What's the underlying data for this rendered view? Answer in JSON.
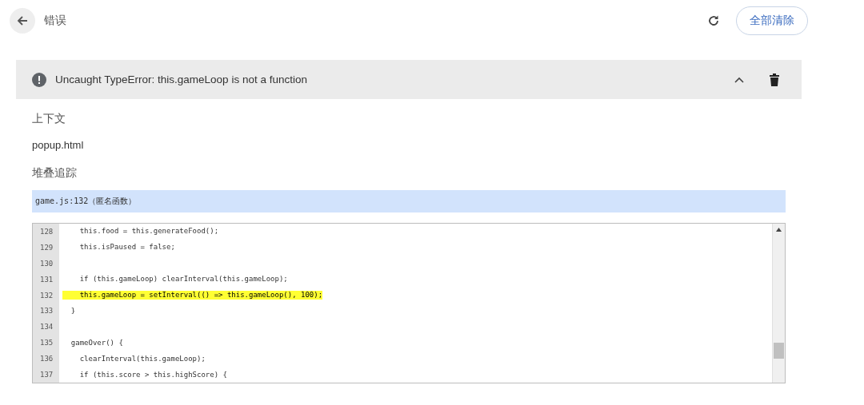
{
  "header": {
    "title": "错误",
    "clear_all_button": "全部清除"
  },
  "error": {
    "message": "Uncaught TypeError: this.gameLoop is not a function",
    "expanded": true,
    "context_label": "上下文",
    "context": "popup.html",
    "stack_label": "堆叠追踪",
    "stack_frames": [
      {
        "text": "game.js:132（匿名函数）",
        "selected": true
      }
    ]
  },
  "code": {
    "lines": [
      {
        "number": "128",
        "text": "    this.food = this.generateFood();",
        "highlighted": false
      },
      {
        "number": "129",
        "text": "    this.isPaused = false;",
        "highlighted": false
      },
      {
        "number": "130",
        "highlighted": false
      },
      {
        "number": "131",
        "text": "    if (this.gameLoop) clearInterval(this.gameLoop);",
        "highlighted": false
      },
      {
        "number": "132",
        "text": "    this.gameLoop = setInterval(() => this.gameLoop(), 100);",
        "highlighted": true
      },
      {
        "number": "133",
        "text": "  }",
        "highlighted": false
      },
      {
        "number": "134",
        "highlighted": false
      },
      {
        "number": "135",
        "text": "  gameOver() {",
        "highlighted": false
      },
      {
        "number": "136",
        "text": "    clearInterval(this.gameLoop);",
        "highlighted": false
      },
      {
        "number": "137",
        "text": "    if (this.score > this.highScore) {",
        "highlighted": false
      }
    ]
  }
}
